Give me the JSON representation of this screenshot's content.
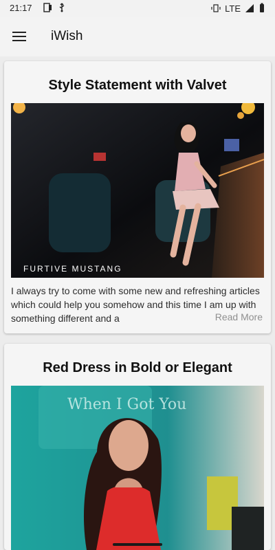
{
  "status_bar": {
    "time": "21:17",
    "network": "LTE",
    "icons": [
      "notification-icon",
      "usb-icon",
      "vibrate-icon",
      "signal-icon",
      "battery-icon"
    ]
  },
  "app_bar": {
    "title": "iWish",
    "menu_icon": "menu-icon"
  },
  "articles": [
    {
      "title": "Style Statement with Valvet",
      "image_caption": "FURTIVE MUSTANG",
      "excerpt": "I always try to come with some new and refreshing articles which could help you somehow and this time I am up with something different and a",
      "read_more": "Read More"
    },
    {
      "title": "Red Dress in Bold or Elegant",
      "image_sign_text": "When I Got You"
    }
  ],
  "colors": {
    "app_bar_bg": "#f3f3f3",
    "card_bg": "#f5f5f5",
    "read_more": "#8f8f8f"
  }
}
